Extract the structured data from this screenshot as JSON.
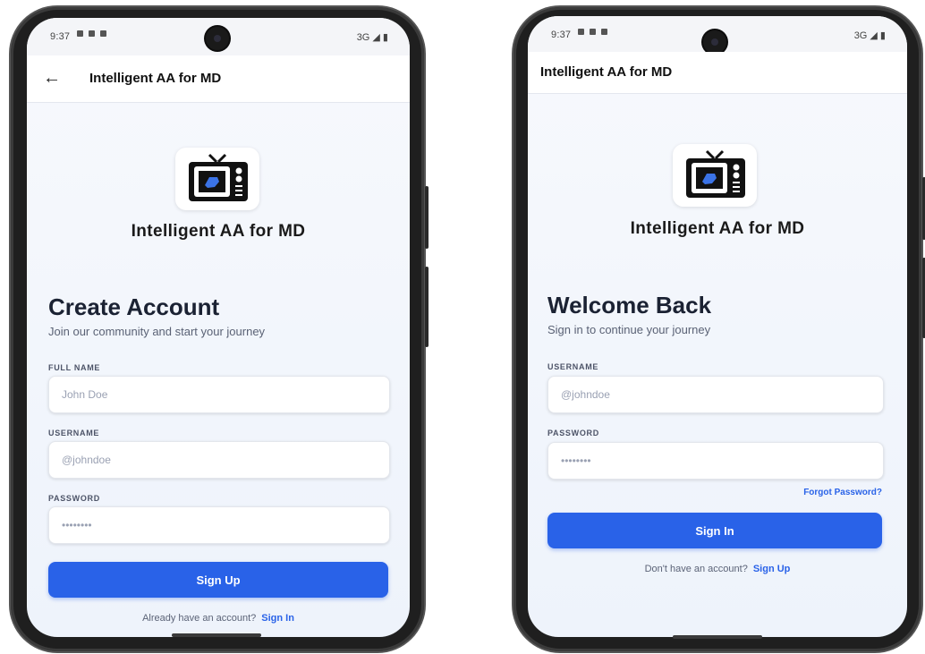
{
  "status": {
    "time": "9:37",
    "network": "3G ◢ ▮"
  },
  "signup": {
    "appbar_title": "Intelligent AA for MD",
    "back_icon": "arrow-left-icon",
    "app_name": "Intelligent AA for MD",
    "heading": "Create Account",
    "subheading": "Join our community and start your journey",
    "fullname_label": "FULL NAME",
    "fullname_placeholder": "John Doe",
    "username_label": "USERNAME",
    "username_placeholder": "@johndoe",
    "password_label": "PASSWORD",
    "password_placeholder": "••••••••",
    "submit_label": "Sign Up",
    "footer_text": "Already have an account?",
    "footer_link": "Sign In"
  },
  "signin": {
    "appbar_title": "Intelligent AA for MD",
    "app_name": "Intelligent AA for MD",
    "heading": "Welcome Back",
    "subheading": "Sign in to continue your journey",
    "username_label": "USERNAME",
    "username_placeholder": "@johndoe",
    "password_label": "PASSWORD",
    "password_placeholder": "••••••••",
    "forgot_label": "Forgot Password?",
    "submit_label": "Sign In",
    "footer_text": "Don't have an account?",
    "footer_link": "Sign Up"
  },
  "colors": {
    "accent": "#2962e8",
    "heading": "#1b2233",
    "background": "#f2f5fb"
  }
}
